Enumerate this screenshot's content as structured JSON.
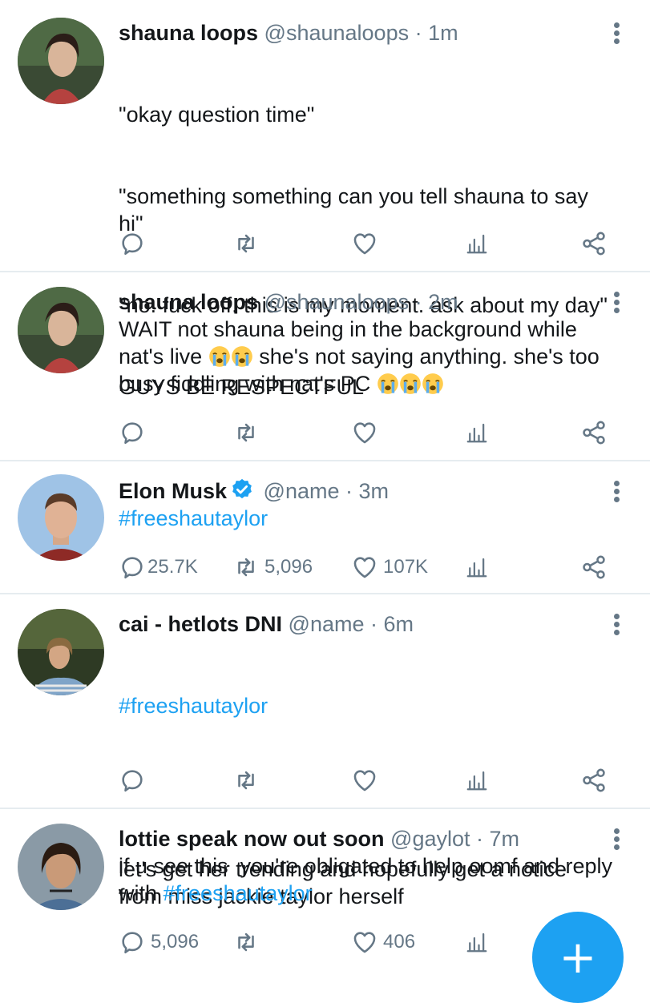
{
  "tweets": [
    {
      "name": "shauna loops",
      "handle": "@shaunaloops",
      "time": "· 1m",
      "lines": [
        "\"okay question time\"",
        "\"something something can you tell shauna to say hi\"",
        "\"no. fuck off. this is my moment. ask about my day\"",
        "GUYS BE RESPECTFUL"
      ],
      "reply": "",
      "retweet": "",
      "like": ""
    },
    {
      "name": "shauna loops",
      "handle": "@shaunaloops",
      "time": "· 2m",
      "text1": "WAIT not shauna being in the background while nat's live",
      "text2": " she's not saying anything. she's too busy fiddling with nat's PC",
      "reply": "",
      "retweet": "",
      "like": ""
    },
    {
      "name": "Elon Musk",
      "handle": "@name",
      "time": "· 3m",
      "hashtag": "#freeshautaylor",
      "reply": "25.7K",
      "retweet": "5,096",
      "like": "107K"
    },
    {
      "name": "cai - hetlots DNI",
      "handle": "@name",
      "time": "· 6m",
      "hashtag": "#freeshautaylor",
      "text": "let's get her trending and hopefully get a notice from miss jackie taylor herself",
      "reply": "",
      "retweet": "",
      "like": ""
    },
    {
      "name": "lottie speak now out soon",
      "handle": "@gaylot",
      "time": "· 7m",
      "text": "if u see this  you're obligated to help oomf and reply with ",
      "hashtag": "#freeshautaylor",
      "reply": "5,096",
      "retweet": "",
      "like": "406"
    }
  ],
  "fab": {
    "icon": "+"
  },
  "colors": {
    "link": "#1da1f2",
    "muted": "#657786",
    "divider": "#e6ecf0"
  },
  "icons": [
    "reply-icon",
    "retweet-icon",
    "like-icon",
    "analytics-icon",
    "share-icon",
    "more-options-icon",
    "verified-badge-icon",
    "loudly-crying-face-emoji",
    "compose-icon"
  ]
}
